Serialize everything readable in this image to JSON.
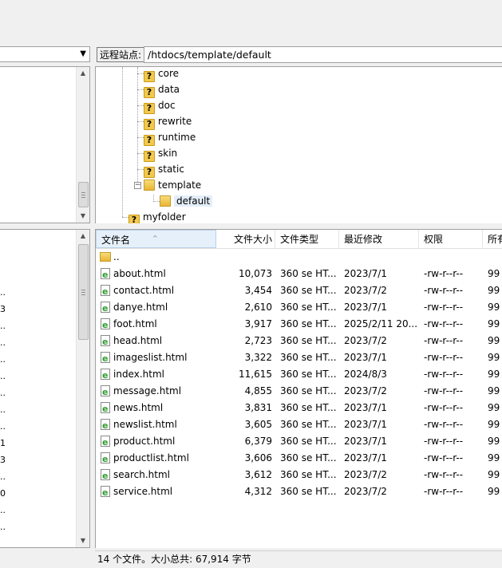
{
  "remote": {
    "site_label": "远程站点:",
    "path": "/htdocs/template/default",
    "tree": [
      {
        "label": "core",
        "icon": "unknown-folder-icon"
      },
      {
        "label": "data",
        "icon": "unknown-folder-icon"
      },
      {
        "label": "doc",
        "icon": "unknown-folder-icon"
      },
      {
        "label": "rewrite",
        "icon": "unknown-folder-icon"
      },
      {
        "label": "runtime",
        "icon": "unknown-folder-icon"
      },
      {
        "label": "skin",
        "icon": "unknown-folder-icon"
      },
      {
        "label": "static",
        "icon": "unknown-folder-icon"
      },
      {
        "label": "template",
        "icon": "folder-icon"
      },
      {
        "label": "default",
        "icon": "folder-icon"
      },
      {
        "label": "myfolder",
        "icon": "unknown-folder-icon"
      }
    ],
    "columns": {
      "name": "文件名",
      "size": "文件大小",
      "type": "文件类型",
      "modified": "最近修改",
      "perms": "权限",
      "owner": "所有"
    },
    "parent_dir": "..",
    "files": [
      {
        "name": "about.html",
        "size": "10,073",
        "type": "360 se HT...",
        "modified": "2023/7/1",
        "perms": "-rw-r--r--",
        "owner": "99"
      },
      {
        "name": "contact.html",
        "size": "3,454",
        "type": "360 se HT...",
        "modified": "2023/7/2",
        "perms": "-rw-r--r--",
        "owner": "99"
      },
      {
        "name": "danye.html",
        "size": "2,610",
        "type": "360 se HT...",
        "modified": "2023/7/1",
        "perms": "-rw-r--r--",
        "owner": "99"
      },
      {
        "name": "foot.html",
        "size": "3,917",
        "type": "360 se HT...",
        "modified": "2025/2/11 20...",
        "perms": "-rw-r--r--",
        "owner": "99"
      },
      {
        "name": "head.html",
        "size": "2,723",
        "type": "360 se HT...",
        "modified": "2023/7/2",
        "perms": "-rw-r--r--",
        "owner": "99"
      },
      {
        "name": "imageslist.html",
        "size": "3,322",
        "type": "360 se HT...",
        "modified": "2023/7/1",
        "perms": "-rw-r--r--",
        "owner": "99"
      },
      {
        "name": "index.html",
        "size": "11,615",
        "type": "360 se HT...",
        "modified": "2024/8/3",
        "perms": "-rw-r--r--",
        "owner": "99"
      },
      {
        "name": "message.html",
        "size": "4,855",
        "type": "360 se HT...",
        "modified": "2023/7/2",
        "perms": "-rw-r--r--",
        "owner": "99"
      },
      {
        "name": "news.html",
        "size": "3,831",
        "type": "360 se HT...",
        "modified": "2023/7/1",
        "perms": "-rw-r--r--",
        "owner": "99"
      },
      {
        "name": "newslist.html",
        "size": "3,605",
        "type": "360 se HT...",
        "modified": "2023/7/1",
        "perms": "-rw-r--r--",
        "owner": "99"
      },
      {
        "name": "product.html",
        "size": "6,379",
        "type": "360 se HT...",
        "modified": "2023/7/1",
        "perms": "-rw-r--r--",
        "owner": "99"
      },
      {
        "name": "productlist.html",
        "size": "3,606",
        "type": "360 se HT...",
        "modified": "2023/7/1",
        "perms": "-rw-r--r--",
        "owner": "99"
      },
      {
        "name": "search.html",
        "size": "3,612",
        "type": "360 se HT...",
        "modified": "2023/7/2",
        "perms": "-rw-r--r--",
        "owner": "99"
      },
      {
        "name": "service.html",
        "size": "4,312",
        "type": "360 se HT...",
        "modified": "2023/7/2",
        "perms": "-rw-r--r--",
        "owner": "99"
      }
    ],
    "status": "14 个文件。大小总共: 67,914 字节"
  },
  "local": {
    "list_edge_chars": [
      "..",
      "3",
      "..",
      "..",
      "..",
      "..",
      "..",
      "..",
      "..",
      "1",
      "3",
      "..",
      "0",
      "..",
      ".."
    ]
  }
}
